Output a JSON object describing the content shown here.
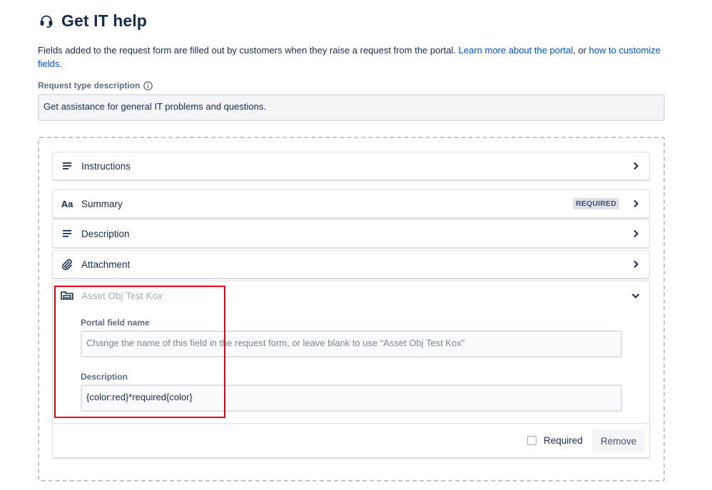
{
  "header": {
    "title": "Get IT help",
    "icon": "headset-icon"
  },
  "intro": {
    "text_before": "Fields added to the request form are filled out by customers when they raise a request from the portal. ",
    "link1": "Learn more about the portal",
    "text_middle": ", or ",
    "link2": "how to customize fields",
    "text_after": "."
  },
  "request_type": {
    "label": "Request type description",
    "value": "Get assistance for general IT problems and questions."
  },
  "fields": [
    {
      "label": "Instructions",
      "icon": "text-lines-icon"
    },
    {
      "label": "Summary",
      "icon": "text-format-icon",
      "badge": "REQUIRED"
    },
    {
      "label": "Description",
      "icon": "text-lines-icon"
    },
    {
      "label": "Attachment",
      "icon": "paperclip-icon"
    }
  ],
  "expanded_field": {
    "label": "Asset Obj Test Kox",
    "icon": "asset-object-icon",
    "portal_name_label": "Portal field name",
    "portal_name_placeholder": "Change the name of this field in the request form, or leave blank to use “Asset Obj Test Kox”",
    "description_label": "Description",
    "description_value": "{color:red}*required{color}",
    "required_label": "Required",
    "required_checked": false,
    "remove_label": "Remove"
  },
  "colors": {
    "link": "#0052cc",
    "highlight": "#e2001a",
    "text": "#172b4d"
  }
}
